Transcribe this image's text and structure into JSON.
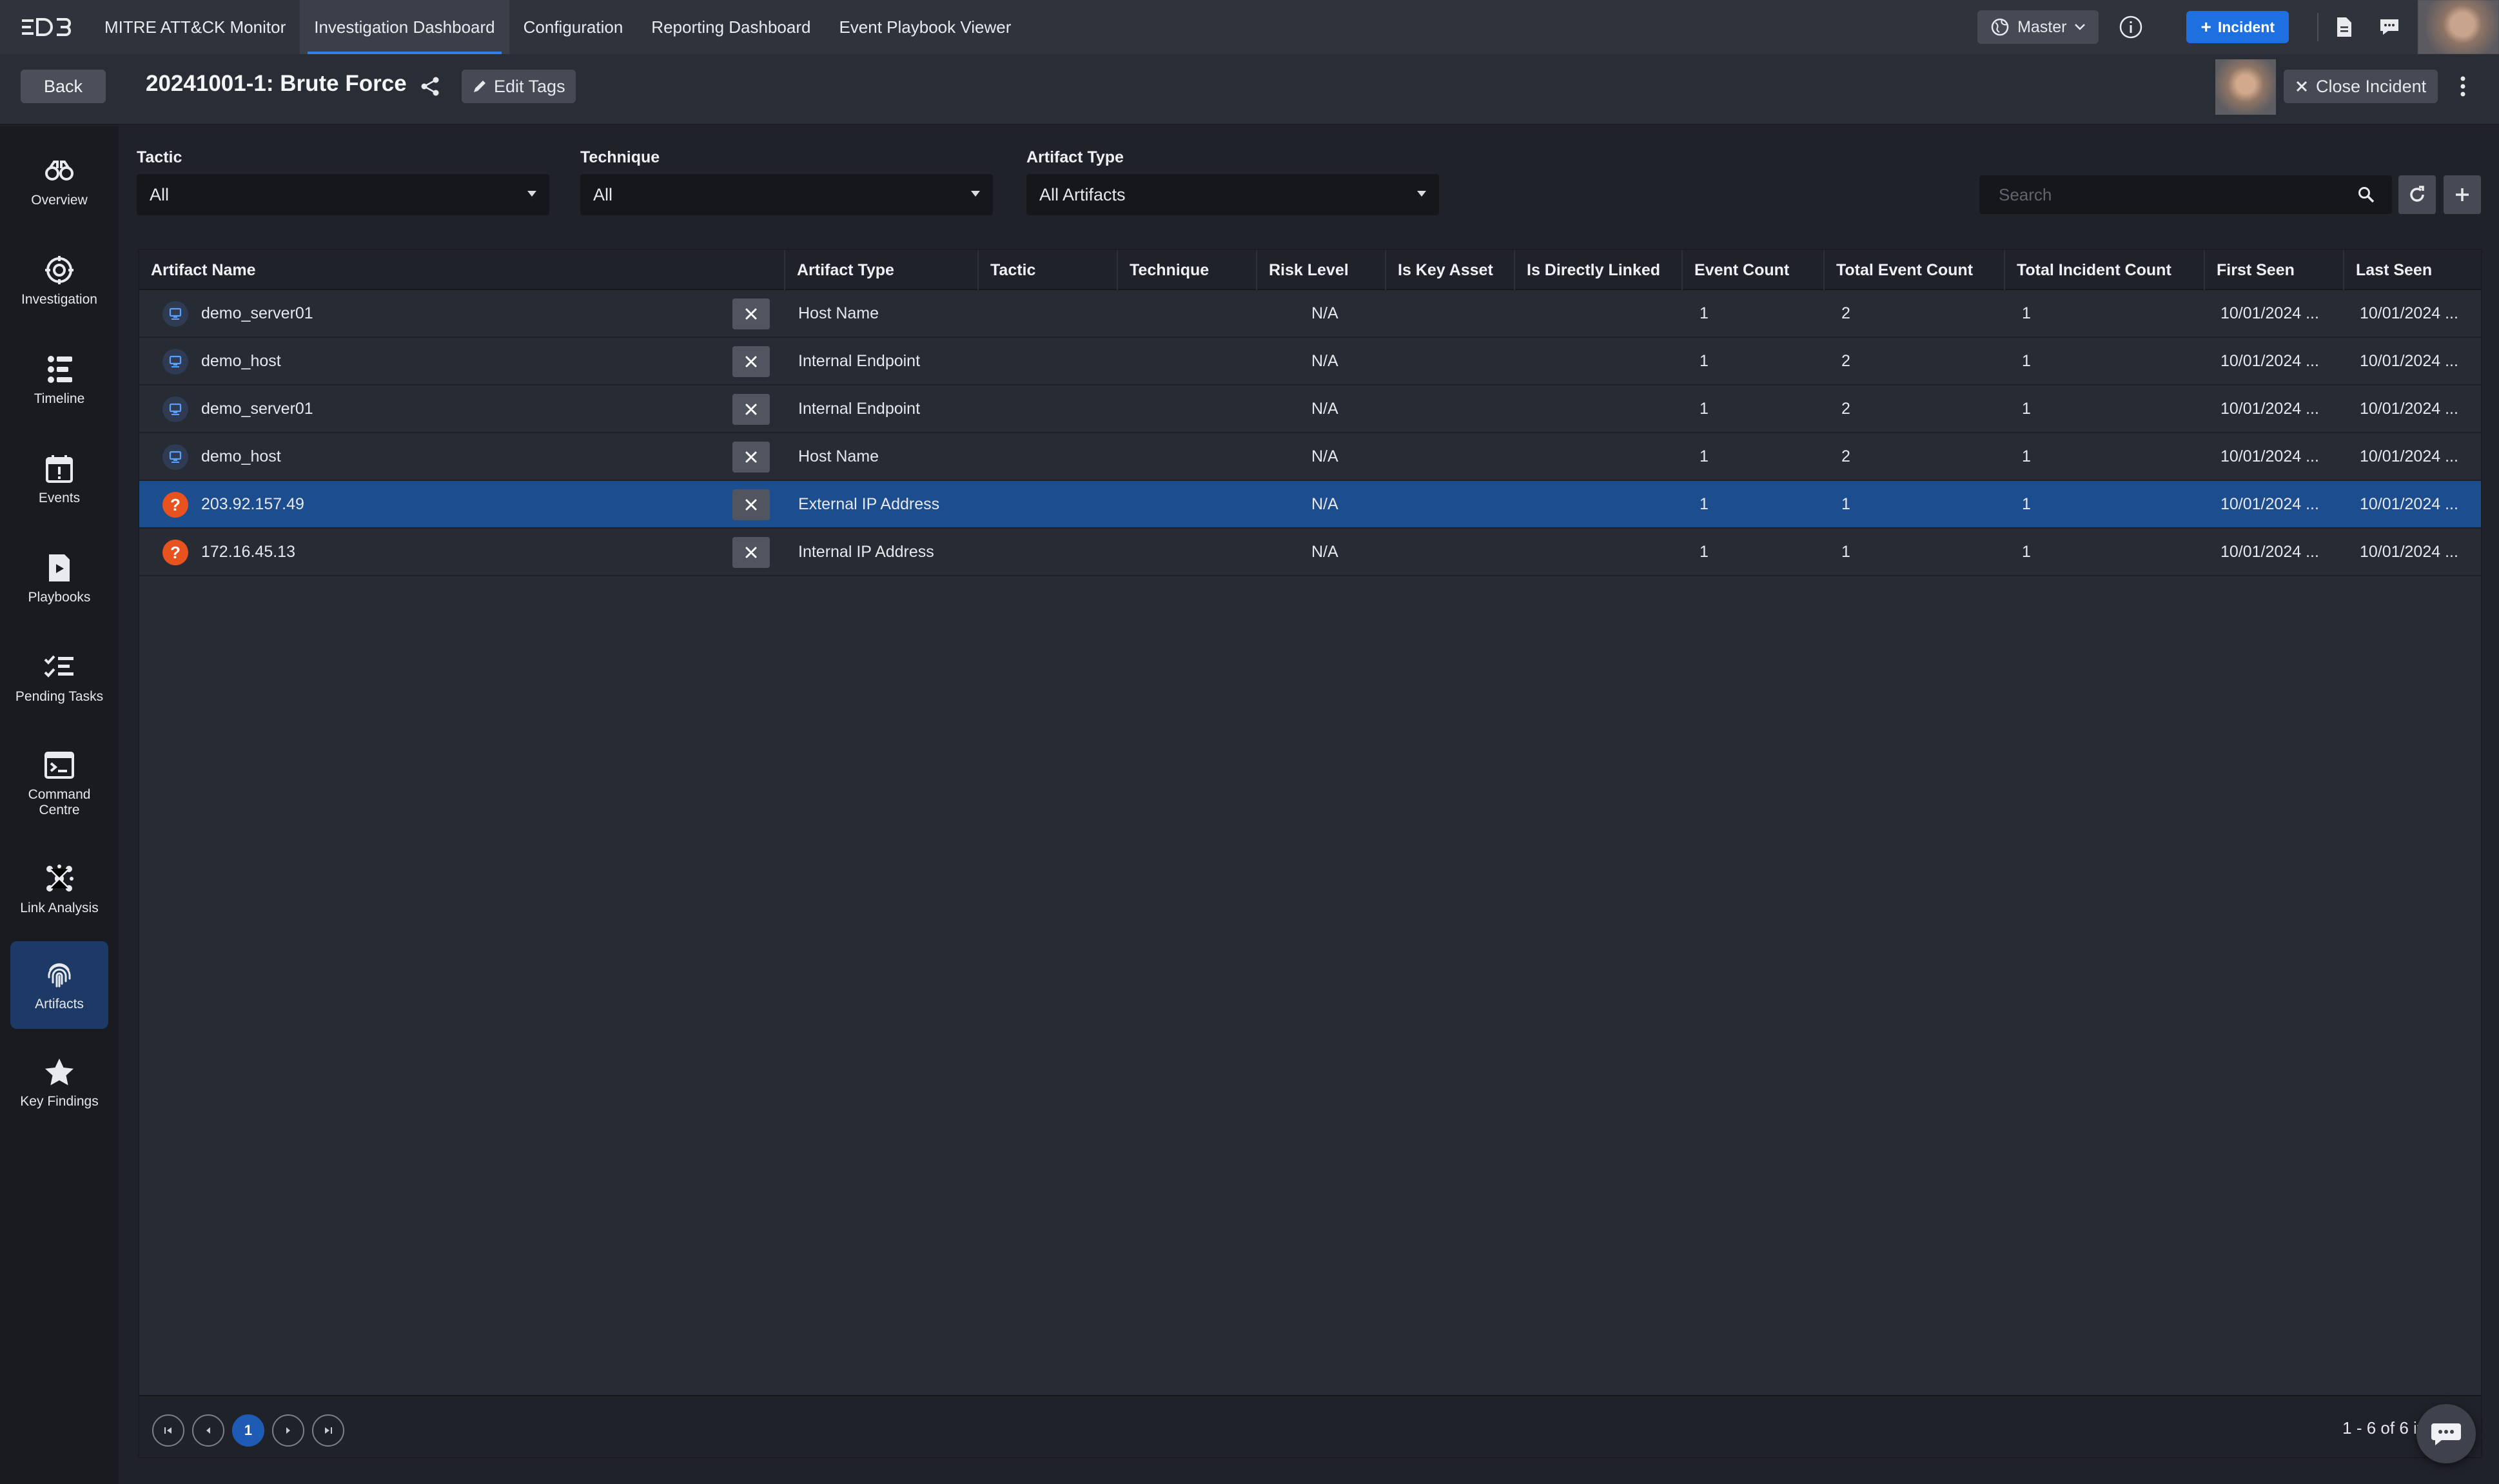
{
  "nav": {
    "logo_text": "D3",
    "links": [
      {
        "label": "MITRE ATT&CK Monitor",
        "active": false
      },
      {
        "label": "Investigation Dashboard",
        "active": true
      },
      {
        "label": "Configuration",
        "active": false
      },
      {
        "label": "Reporting Dashboard",
        "active": false
      },
      {
        "label": "Event Playbook Viewer",
        "active": false
      }
    ],
    "master_label": "Master",
    "incident_button": "Incident"
  },
  "header": {
    "back_label": "Back",
    "title": "20241001-1: Brute Force",
    "edit_tags_label": "Edit Tags",
    "close_incident_label": "Close Incident"
  },
  "sidebar": {
    "items": [
      {
        "label": "Overview",
        "icon": "binoculars-icon"
      },
      {
        "label": "Investigation",
        "icon": "target-icon"
      },
      {
        "label": "Timeline",
        "icon": "timeline-icon"
      },
      {
        "label": "Events",
        "icon": "calendar-alert-icon"
      },
      {
        "label": "Playbooks",
        "icon": "playbook-icon"
      },
      {
        "label": "Pending Tasks",
        "icon": "checklist-icon"
      },
      {
        "label": "Command Centre",
        "icon": "terminal-icon"
      },
      {
        "label": "Link Analysis",
        "icon": "network-icon"
      },
      {
        "label": "Artifacts",
        "icon": "fingerprint-icon",
        "active": true
      },
      {
        "label": "Key Findings",
        "icon": "star-icon"
      }
    ]
  },
  "filters": {
    "tactic": {
      "label": "Tactic",
      "value": "All"
    },
    "technique": {
      "label": "Technique",
      "value": "All"
    },
    "artifact_type": {
      "label": "Artifact Type",
      "value": "All Artifacts"
    },
    "search_placeholder": "Search"
  },
  "table": {
    "columns": [
      "Artifact Name",
      "Artifact Type",
      "Tactic",
      "Technique",
      "Risk Level",
      "Is Key Asset",
      "Is Directly Linked",
      "Event Count",
      "Total Event Count",
      "Total Incident Count",
      "First Seen",
      "Last Seen"
    ],
    "rows": [
      {
        "name": "demo_server01",
        "icon": "host-icon",
        "type": "Host Name",
        "tactic": "",
        "technique": "",
        "risk": "N/A",
        "key_asset": "",
        "direct": "",
        "event_count": "1",
        "total_event_count": "2",
        "total_incident_count": "1",
        "first_seen": "10/01/2024 ...",
        "last_seen": "10/01/2024 ...",
        "selected": false
      },
      {
        "name": "demo_host",
        "icon": "host-icon",
        "type": "Internal Endpoint",
        "tactic": "",
        "technique": "",
        "risk": "N/A",
        "key_asset": "",
        "direct": "",
        "event_count": "1",
        "total_event_count": "2",
        "total_incident_count": "1",
        "first_seen": "10/01/2024 ...",
        "last_seen": "10/01/2024 ...",
        "selected": false
      },
      {
        "name": "demo_server01",
        "icon": "host-icon",
        "type": "Internal Endpoint",
        "tactic": "",
        "technique": "",
        "risk": "N/A",
        "key_asset": "",
        "direct": "",
        "event_count": "1",
        "total_event_count": "2",
        "total_incident_count": "1",
        "first_seen": "10/01/2024 ...",
        "last_seen": "10/01/2024 ...",
        "selected": false
      },
      {
        "name": "demo_host",
        "icon": "host-icon",
        "type": "Host Name",
        "tactic": "",
        "technique": "",
        "risk": "N/A",
        "key_asset": "",
        "direct": "",
        "event_count": "1",
        "total_event_count": "2",
        "total_incident_count": "1",
        "first_seen": "10/01/2024 ...",
        "last_seen": "10/01/2024 ...",
        "selected": false
      },
      {
        "name": "203.92.157.49",
        "icon": "unknown-ip-icon",
        "type": "External IP Address",
        "tactic": "",
        "technique": "",
        "risk": "N/A",
        "key_asset": "",
        "direct": "",
        "event_count": "1",
        "total_event_count": "1",
        "total_incident_count": "1",
        "first_seen": "10/01/2024 ...",
        "last_seen": "10/01/2024 ...",
        "selected": true
      },
      {
        "name": "172.16.45.13",
        "icon": "unknown-ip-icon",
        "type": "Internal IP Address",
        "tactic": "",
        "technique": "",
        "risk": "N/A",
        "key_asset": "",
        "direct": "",
        "event_count": "1",
        "total_event_count": "1",
        "total_incident_count": "1",
        "first_seen": "10/01/2024 ...",
        "last_seen": "10/01/2024 ...",
        "selected": false
      }
    ]
  },
  "pager": {
    "current_page": "1",
    "info": "1 - 6 of 6 it"
  },
  "colors": {
    "accent": "#1e6fe0",
    "selected_row": "#1c4d8e",
    "unknown_ip": "#e8521f"
  }
}
